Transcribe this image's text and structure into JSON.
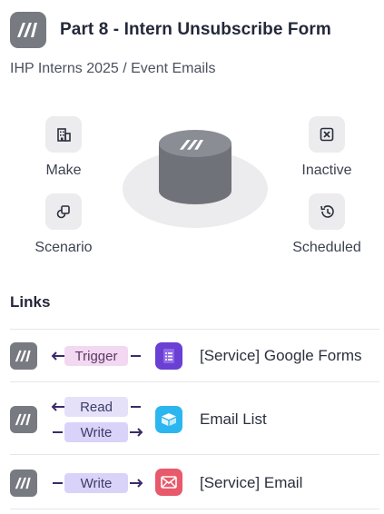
{
  "header": {
    "title": "Part 8 - Intern Unsubscribe Form",
    "breadcrumb": "IHP Interns 2025 / Event Emails",
    "logo_icon": "make-logo-icon"
  },
  "overview": {
    "left_top": {
      "icon": "building-icon",
      "label": "Make"
    },
    "left_bottom": {
      "icon": "scenario-icon",
      "label": "Scenario"
    },
    "right_top": {
      "icon": "close-box-icon",
      "label": "Inactive"
    },
    "right_bottom": {
      "icon": "history-icon",
      "label": "Scheduled"
    }
  },
  "links": {
    "title": "Links",
    "rows": [
      {
        "labels": [
          "Trigger"
        ],
        "service": "[Service] Google Forms",
        "service_icon": "google-forms-icon",
        "service_color": "#6a3fd4"
      },
      {
        "labels": [
          "Read",
          "Write"
        ],
        "service": "Email List",
        "service_icon": "datastore-icon",
        "service_color": "#2bb6ef"
      },
      {
        "labels": [
          "Write"
        ],
        "service": "[Service] Email",
        "service_icon": "email-icon",
        "service_color": "#e8596b"
      }
    ]
  },
  "colors": {
    "logo_gray": "#777a80",
    "arrow_purple": "#3b2a6b",
    "trigger_pill": "#f3d8f1",
    "read_pill": "#e4e1f9",
    "write_pill": "#d9d3f9"
  }
}
